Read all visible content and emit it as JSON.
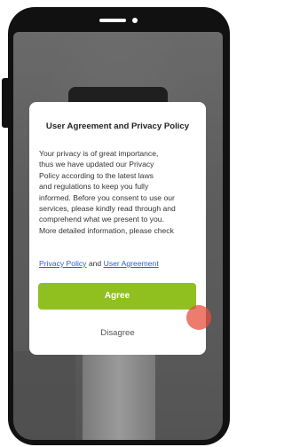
{
  "dialog": {
    "title": "User Agreement and Privacy Policy",
    "body_lines": [
      "Your privacy is of great importance,",
      "thus we have updated our Privacy",
      "Policy according to the latest laws",
      "and regulations to keep you fully",
      "informed. Before you consent to use our",
      "services, please kindly read through and",
      "comprehend what we present to you.",
      "More detailed information, please check"
    ],
    "link_privacy": "Privacy Policy",
    "link_and": "and",
    "link_user_agreement": "User Agreement",
    "agree_label": "Agree",
    "disagree_label": "Disagree"
  },
  "colors": {
    "agree_bg": "#8fc01f",
    "link": "#2a5fcf",
    "touch_indicator": "#e6503c"
  }
}
